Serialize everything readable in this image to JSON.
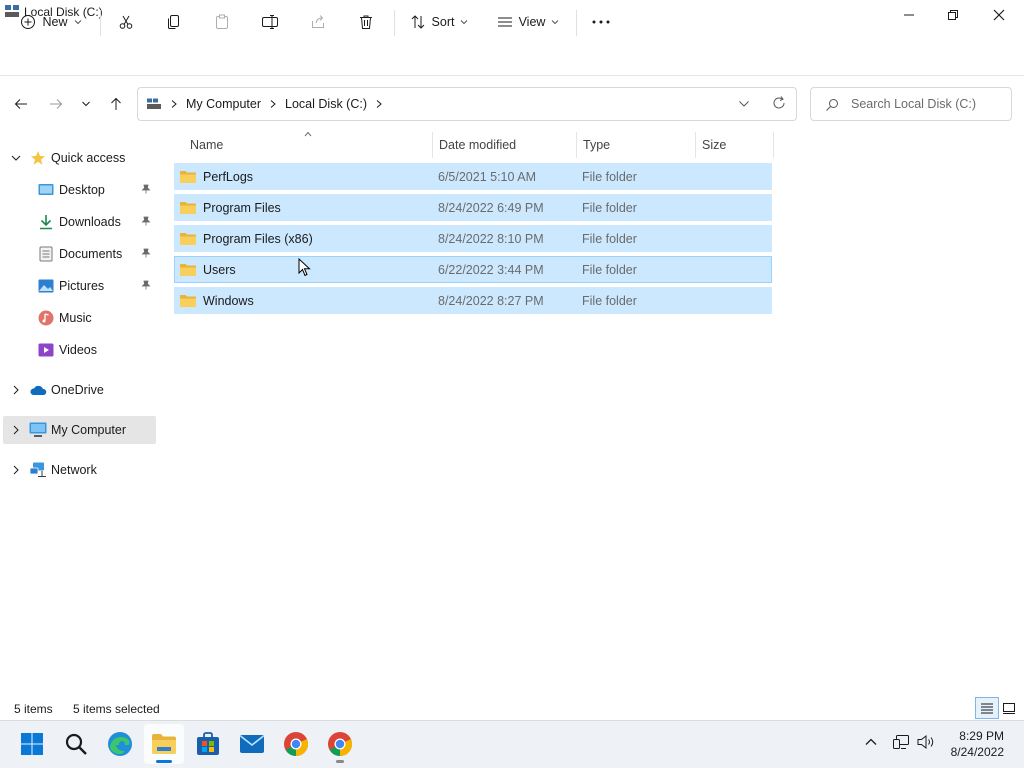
{
  "window": {
    "title": "Local Disk (C:)"
  },
  "toolbar": {
    "new_label": "New",
    "sort_label": "Sort",
    "view_label": "View"
  },
  "address": {
    "root": "My Computer",
    "current": "Local Disk (C:)"
  },
  "search": {
    "placeholder": "Search Local Disk (C:)"
  },
  "sidebar": {
    "items": [
      {
        "label": "Quick access",
        "icon": "star-icon"
      },
      {
        "label": "Desktop",
        "icon": "desktop-icon",
        "pinned": true
      },
      {
        "label": "Downloads",
        "icon": "download-icon",
        "pinned": true
      },
      {
        "label": "Documents",
        "icon": "document-icon",
        "pinned": true
      },
      {
        "label": "Pictures",
        "icon": "picture-icon",
        "pinned": true
      },
      {
        "label": "Music",
        "icon": "music-icon"
      },
      {
        "label": "Videos",
        "icon": "video-icon"
      },
      {
        "label": "OneDrive",
        "icon": "cloud-icon"
      },
      {
        "label": "My Computer",
        "icon": "computer-icon",
        "selected": true
      },
      {
        "label": "Network",
        "icon": "network-icon"
      }
    ]
  },
  "columns": [
    "Name",
    "Date modified",
    "Type",
    "Size"
  ],
  "files": [
    {
      "name": "PerfLogs",
      "date": "6/5/2021 5:10 AM",
      "type": "File folder"
    },
    {
      "name": "Program Files",
      "date": "8/24/2022 6:49 PM",
      "type": "File folder"
    },
    {
      "name": "Program Files (x86)",
      "date": "8/24/2022 8:10 PM",
      "type": "File folder"
    },
    {
      "name": "Users",
      "date": "6/22/2022 3:44 PM",
      "type": "File folder"
    },
    {
      "name": "Windows",
      "date": "8/24/2022 8:27 PM",
      "type": "File folder"
    }
  ],
  "status": {
    "count": "5 items",
    "selected": "5 items selected"
  },
  "clock": {
    "time": "8:29 PM",
    "date": "8/24/2022"
  },
  "colors": {
    "selection": "#cce8ff",
    "folder": "#f4c542",
    "accent": "#0067c0"
  }
}
